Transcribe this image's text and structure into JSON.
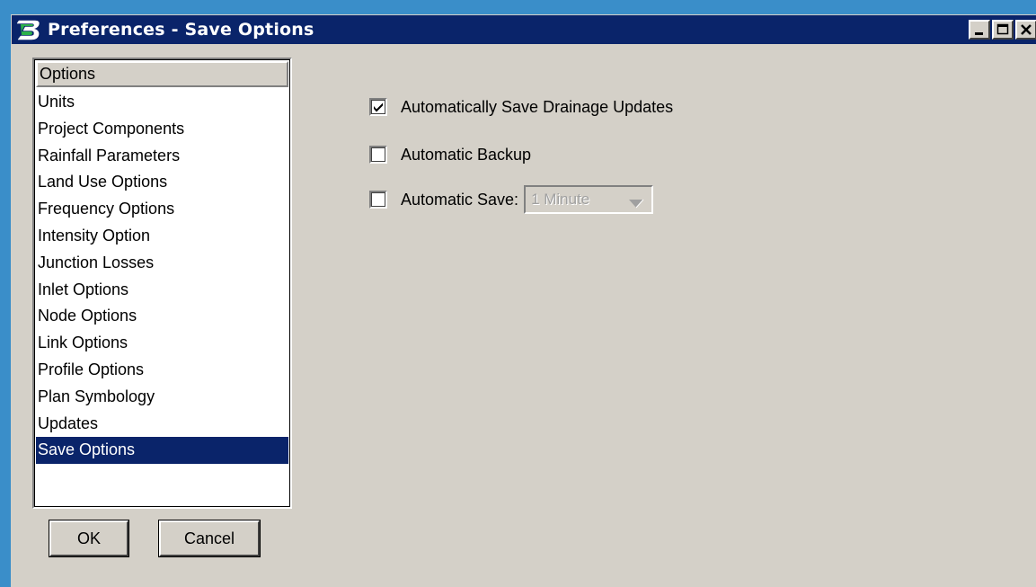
{
  "window": {
    "title": "Preferences - Save Options"
  },
  "options_list": {
    "header": "Options",
    "items": [
      {
        "label": "Units"
      },
      {
        "label": "Project Components"
      },
      {
        "label": "Rainfall Parameters"
      },
      {
        "label": "Land Use Options"
      },
      {
        "label": "Frequency Options"
      },
      {
        "label": "Intensity Option"
      },
      {
        "label": "Junction Losses"
      },
      {
        "label": "Inlet Options"
      },
      {
        "label": "Node Options"
      },
      {
        "label": "Link Options"
      },
      {
        "label": "Profile Options"
      },
      {
        "label": "Plan Symbology"
      },
      {
        "label": "Updates"
      },
      {
        "label": "Save Options"
      }
    ],
    "selected": "Save Options"
  },
  "buttons": {
    "ok": "OK",
    "cancel": "Cancel"
  },
  "save_options": {
    "auto_save_drainage": {
      "label": "Automatically Save Drainage Updates",
      "checked": true
    },
    "auto_backup": {
      "label": "Automatic Backup",
      "checked": false
    },
    "auto_save": {
      "label": "Automatic Save:",
      "checked": false,
      "interval": "1 Minute",
      "interval_enabled": false
    }
  },
  "colors": {
    "titlebar": "#0a246a",
    "dialog_bg": "#d4d0c8",
    "selection": "#0a246a",
    "desktop": "#3a8ec9"
  },
  "icons": {
    "app": "bentley-b-icon",
    "minimize": "minimize-icon",
    "maximize": "maximize-icon",
    "close": "close-icon",
    "check": "checkmark-icon",
    "dropdown": "triangle-down-icon"
  }
}
